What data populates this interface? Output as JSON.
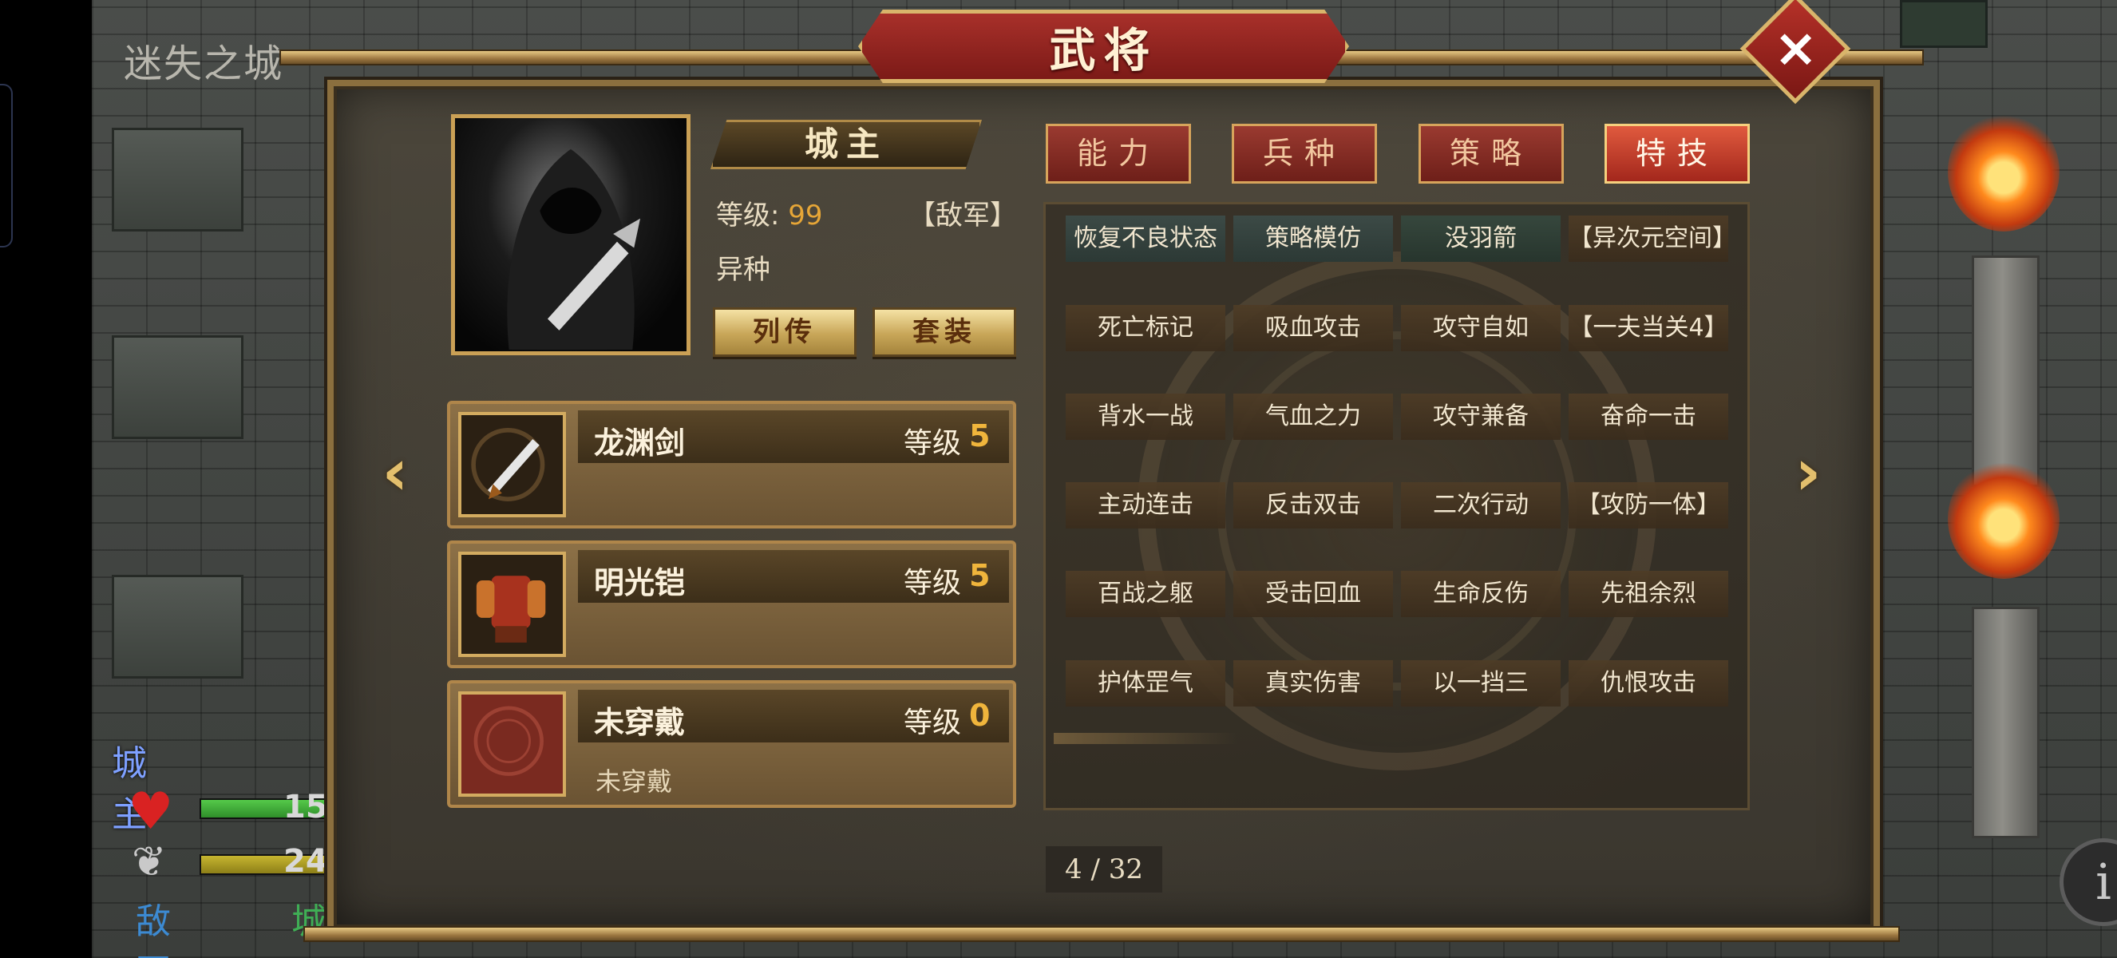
{
  "map": {
    "title": "迷失之城",
    "hud": {
      "unit_name": "城主",
      "hp_value": "15",
      "mp_value": "24",
      "camp_label": "敌军",
      "city_label": "城"
    }
  },
  "dialog": {
    "title": "武将",
    "close_icon": "close-icon",
    "general": {
      "name": "城主",
      "level_label": "等级:",
      "level_value": "99",
      "camp": "【敌军】",
      "type": "异种",
      "biography_button": "列传",
      "outfit_button": "套装"
    },
    "equipment": [
      {
        "name": "龙渊剑",
        "level_label": "等级",
        "level": "5",
        "subtitle": "",
        "icon": "sword-icon"
      },
      {
        "name": "明光铠",
        "level_label": "等级",
        "level": "5",
        "subtitle": "",
        "icon": "armor-icon"
      },
      {
        "name": "未穿戴",
        "level_label": "等级",
        "level": "0",
        "subtitle": "未穿戴",
        "icon": "empty-slot-icon"
      }
    ],
    "tabs": [
      {
        "label": "能力",
        "active": false
      },
      {
        "label": "兵种",
        "active": false
      },
      {
        "label": "策略",
        "active": false
      },
      {
        "label": "特技",
        "active": true
      }
    ],
    "skills": [
      [
        "恢复不良状态",
        "策略模仿",
        "没羽箭",
        "【异次元空间】"
      ],
      [
        "死亡标记",
        "吸血攻击",
        "攻守自如",
        "【一夫当关4】"
      ],
      [
        "背水一战",
        "气血之力",
        "攻守兼备",
        "奋命一击"
      ],
      [
        "主动连击",
        "反击双击",
        "二次行动",
        "【攻防一体】"
      ],
      [
        "百战之躯",
        "受击回血",
        "生命反伤",
        "先祖余烈"
      ],
      [
        "护体罡气",
        "真实伤害",
        "以一挡三",
        "仇恨攻击"
      ]
    ],
    "pager": "4 / 32",
    "prev_icon": "chevron-left-icon",
    "next_icon": "chevron-right-icon"
  },
  "colors": {
    "accent_gold": "#caa055",
    "tab_red": "#9a3a30",
    "active_tab": "#e05a3e",
    "level_orange": "#f0b53c"
  }
}
